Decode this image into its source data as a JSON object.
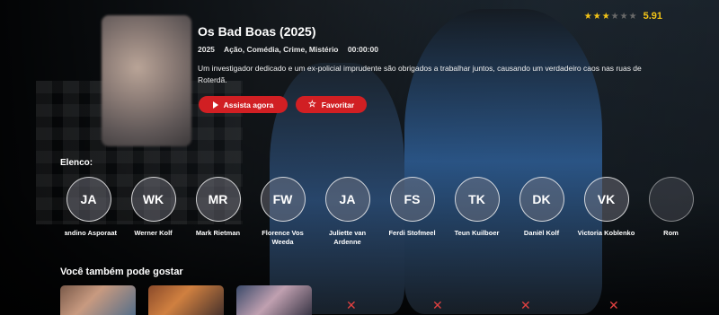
{
  "movie": {
    "title": "Os Bad Boas (2025)",
    "year": "2025",
    "genres": "Ação, Comédia, Crime, Mistério",
    "duration": "00:00:00",
    "description": "Um investigador dedicado e um ex-policial imprudente são obrigados a trabalhar juntos, causando um verdadeiro caos nas ruas de Roterdã.",
    "rating_value": "5.91",
    "rating_stars": 3,
    "rating_max_stars": 6
  },
  "actions": {
    "watch_label": "Assista agora",
    "favorite_label": "Favoritar"
  },
  "cast": {
    "heading": "Elenco:",
    "members": [
      {
        "initials": "JA",
        "name": "Jandino Asporaat"
      },
      {
        "initials": "WK",
        "name": "Werner Kolf"
      },
      {
        "initials": "MR",
        "name": "Mark Rietman"
      },
      {
        "initials": "FW",
        "name": "Florence Vos Weeda"
      },
      {
        "initials": "JA",
        "name": "Juliette van Ardenne"
      },
      {
        "initials": "FS",
        "name": "Ferdi Stofmeel"
      },
      {
        "initials": "TK",
        "name": "Teun Kuilboer"
      },
      {
        "initials": "DK",
        "name": "Daniël Kolf"
      },
      {
        "initials": "VK",
        "name": "Victoria Koblenko"
      },
      {
        "initials": "",
        "name": "Rom"
      }
    ]
  },
  "recommendations": {
    "heading": "Você também pode gostar"
  },
  "colors": {
    "accent": "#d11f23",
    "star": "#f3c417"
  }
}
